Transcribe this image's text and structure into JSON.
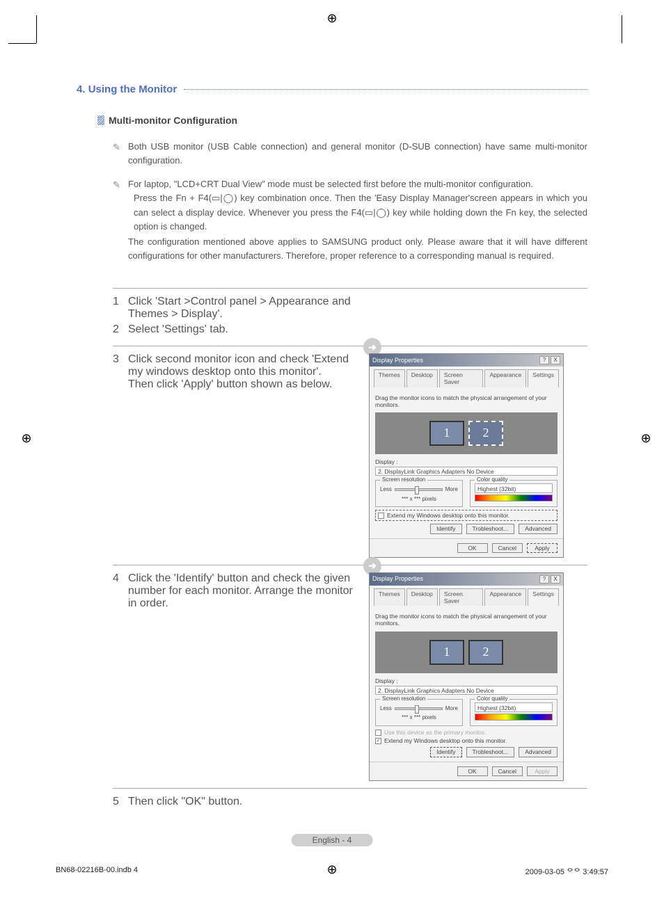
{
  "section_number": "4.",
  "section_title": "Using the Monitor",
  "subheading": "Multi-monitor Configuration",
  "notes": {
    "n1": "Both USB monitor (USB Cable connection) and general monitor (D-SUB connection) have same multi-monitor configuration.",
    "n2_line1": "For laptop, \"LCD+CRT Dual View\" mode must be selected first before the multi-monitor configuration.",
    "n2_line2": "Press the Fn + F4(▭|◯) key combination once. Then the 'Easy Display Manager'screen appears in which you can select a display device. Whenever you press the F4(▭|◯) key while holding down the Fn key, the selected option is changed.",
    "n2_line3": "The configuration mentioned above applies to SAMSUNG product only. Please aware that it will have different configurations for other manufacturers. Therefore, proper reference to a corresponding manual is required."
  },
  "steps": {
    "s1_num": "1",
    "s1": "Click 'Start >Control panel > Appearance and Themes > Display'.",
    "s2_num": "2",
    "s2": "Select 'Settings' tab.",
    "s3_num": "3",
    "s3a": "Click second monitor icon and check 'Extend my windows desktop onto this monitor'.",
    "s3b": "Then click 'Apply' button shown as below.",
    "s4_num": "4",
    "s4": "Click the 'Identify' button and check the given number for each monitor. Arrange the monitor in order.",
    "s5_num": "5",
    "s5": "Then click \"OK\" button."
  },
  "dialog": {
    "title": "Display Properties",
    "help": "?",
    "close": "X",
    "tabs": {
      "themes": "Themes",
      "desktop": "Desktop",
      "screensaver": "Screen Saver",
      "appearance": "Appearance",
      "settings": "Settings"
    },
    "drag_hint": "Drag the monitor icons to match the physical arrangement of your monitors.",
    "mon1": "1",
    "mon2": "2",
    "display_label": "Display :",
    "display_value": "2. DisplayLink Graphics Adapters  No Device",
    "screen_res": "Screen resolution",
    "less": "Less",
    "more": "More",
    "pixels": "*** x ***   pixels",
    "color_quality": "Color quality",
    "color_value": "Highest (32bit)",
    "use_primary": "Use this device as the primary monitor.",
    "extend": "Extend my Windows desktop onto this monitor.",
    "identify": "Identify",
    "troubleshoot": "Trobleshoot...",
    "advanced": "Advanced",
    "ok": "OK",
    "cancel": "Cancel",
    "apply": "Apply"
  },
  "footer": "English - 4",
  "print_left": "BN68-02216B-00.indb   4",
  "print_right": "2009-03-05   ᄋᄋ 3:49:57"
}
